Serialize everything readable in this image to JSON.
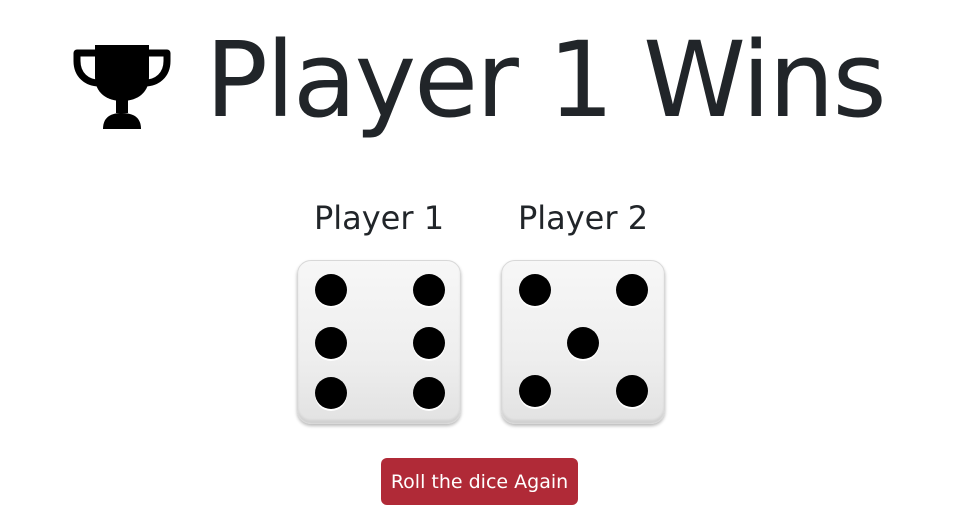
{
  "headline": {
    "title": "Player 1 Wins",
    "icon": "trophy-icon"
  },
  "players": [
    {
      "name": "Player 1",
      "die_value": 6
    },
    {
      "name": "Player 2",
      "die_value": 5
    }
  ],
  "actions": {
    "roll_label": "Roll the dice Again"
  },
  "colors": {
    "text": "#212529",
    "button": "#b02a37",
    "button_text": "#ffffff",
    "pip": "#000000"
  }
}
